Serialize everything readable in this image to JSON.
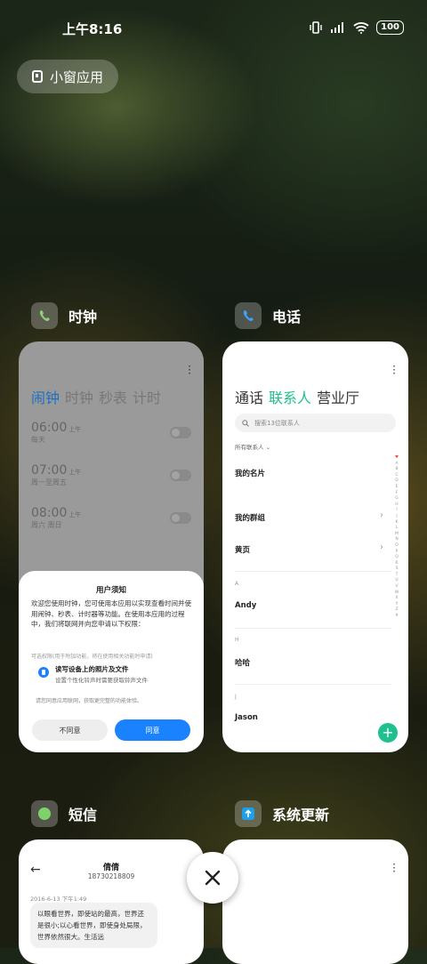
{
  "status": {
    "time": "上午8:16",
    "battery": "100"
  },
  "pill": {
    "label": "小窗应用"
  },
  "clock_app": {
    "name": "时钟",
    "tabs": [
      "闹钟",
      "时钟",
      "秒表",
      "计时"
    ],
    "alarms": [
      {
        "time": "06:00",
        "ampm": "上午",
        "days": "每天"
      },
      {
        "time": "07:00",
        "ampm": "上午",
        "days": "周一至周五"
      },
      {
        "time": "08:00",
        "ampm": "上午",
        "days": "周六 周日"
      }
    ],
    "dialog": {
      "title": "用户须知",
      "body": "欢迎您使用时钟，您可使用本应用以实现查看时间并使用闹钟、秒表、计时器等功能。在使用本应用的过程中，我们将联网并向您申请以下权限：",
      "note": "可选权限(用于附加功能，将在使用相关功能时申请)",
      "perm_title": "读写设备上的照片及文件",
      "perm_desc": "设置个性化铃声时需要获取铃声文件",
      "footer": "请您同意应用联网，获取更完整的功能体验。",
      "cancel": "不同意",
      "agree": "同意"
    }
  },
  "phone_app": {
    "name": "电话",
    "tabs": [
      "通话",
      "联系人",
      "营业厅"
    ],
    "search_placeholder": "搜索13位联系人",
    "all_contacts": "所有联系人",
    "my_card": "我的名片",
    "my_groups": "我的群组",
    "yellow_pages": "黄页",
    "sections": [
      {
        "letter": "A",
        "name": "Andy"
      },
      {
        "letter": "H",
        "name": "哈哈"
      },
      {
        "letter": "J",
        "name": "Jason"
      }
    ],
    "index_letters": [
      "♥",
      "A",
      "B",
      "C",
      "D",
      "E",
      "F",
      "G",
      "H",
      "I",
      "J",
      "K",
      "L",
      "M",
      "N",
      "O",
      "P",
      "Q",
      "R",
      "S",
      "T",
      "U",
      "V",
      "W",
      "X",
      "Y",
      "Z",
      "#"
    ]
  },
  "sms_app": {
    "name": "短信",
    "contact": "倩倩",
    "number": "18730218809",
    "date": "2016-6-13 下午1:49",
    "message": "以眼看世界，即使站的最高，世界还是很小;以心看世界，即使身处局限，世界依然很大。生活远"
  },
  "update_app": {
    "name": "系统更新"
  },
  "colors": {
    "clock_accent": "#1e6fc0",
    "phone_accent": "#1fbf8f",
    "agree_button": "#1a82ff"
  }
}
